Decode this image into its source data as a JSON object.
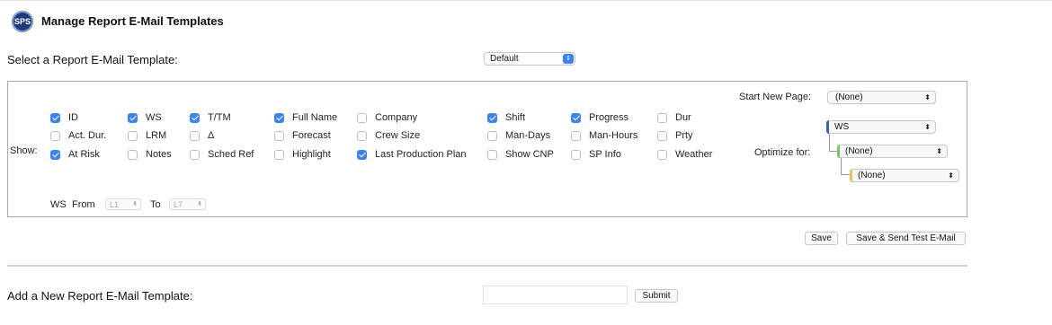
{
  "header": {
    "logo_text": "SPS",
    "title": "Manage Report E-Mail Templates"
  },
  "template_select": {
    "label": "Select a Report E-Mail Template:",
    "value": "Default"
  },
  "panel": {
    "show_label": "Show:",
    "columns": [
      {
        "label": "ID",
        "checked": true
      },
      {
        "label": "WS",
        "checked": true
      },
      {
        "label": "T/TM",
        "checked": true
      },
      {
        "label": "Full Name",
        "checked": true
      },
      {
        "label": "Company",
        "checked": false
      },
      {
        "label": "Shift",
        "checked": true
      },
      {
        "label": "Progress",
        "checked": true
      },
      {
        "label": "Dur",
        "checked": false
      },
      {
        "label": "Act. Dur.",
        "checked": false
      },
      {
        "label": "LRM",
        "checked": false
      },
      {
        "label": "Δ",
        "checked": false
      },
      {
        "label": "Forecast",
        "checked": false
      },
      {
        "label": "Crew Size",
        "checked": false
      },
      {
        "label": "Man-Days",
        "checked": false
      },
      {
        "label": "Man-Hours",
        "checked": false
      },
      {
        "label": "Prty",
        "checked": false
      },
      {
        "label": "At Risk",
        "checked": true
      },
      {
        "label": "Notes",
        "checked": false
      },
      {
        "label": "Sched Ref",
        "checked": false
      },
      {
        "label": "Highlight",
        "checked": false
      },
      {
        "label": "Last Production Plan",
        "checked": true
      },
      {
        "label": "Show CNP",
        "checked": false
      },
      {
        "label": "SP Info",
        "checked": false
      },
      {
        "label": "Weather",
        "checked": false
      }
    ],
    "start_new_page": {
      "label": "Start New Page:",
      "value": "(None)"
    },
    "optimize": {
      "label": "Optimize for:",
      "levels": [
        {
          "value": "WS",
          "color": "#3d5fb0"
        },
        {
          "value": "(None)",
          "color": "#7cc36a"
        },
        {
          "value": "(None)",
          "color": "#f0c060"
        }
      ]
    },
    "ws_range": {
      "ws_label": "WS",
      "from_label": "From",
      "from_value": "L1",
      "to_label": "To",
      "to_value": "L7"
    }
  },
  "actions": {
    "save": "Save",
    "save_send": "Save & Send Test E-Mail"
  },
  "add_new": {
    "label": "Add a New Report E-Mail Template:",
    "input_value": "",
    "submit": "Submit"
  }
}
